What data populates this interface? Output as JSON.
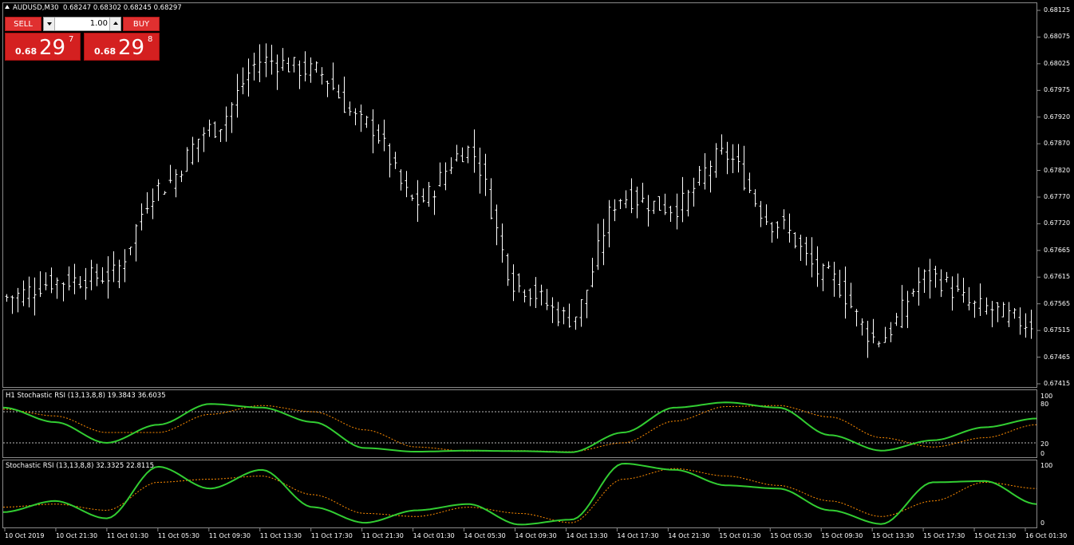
{
  "header": {
    "symbol": "AUDUSD,M30",
    "ohlc": "0.68247 0.68302 0.68245 0.68297"
  },
  "trade_panel": {
    "sell_label": "SELL",
    "buy_label": "BUY",
    "lot": "1.00",
    "sell_price": {
      "prefix": "0.68",
      "big": "29",
      "sup": "7"
    },
    "buy_price": {
      "prefix": "0.68",
      "big": "29",
      "sup": "8"
    }
  },
  "price_axis": [
    "0.68125",
    "0.68075",
    "0.68025",
    "0.67975",
    "0.67920",
    "0.67870",
    "0.67820",
    "0.67770",
    "0.67720",
    "0.67665",
    "0.67615",
    "0.67565",
    "0.67515",
    "0.67465",
    "0.67415"
  ],
  "indicator1": {
    "title": "H1 Stochastic RSI (13,13,8,8) 19.3843 36.6035",
    "levels": [
      "100",
      "80",
      "20",
      "0"
    ]
  },
  "indicator2": {
    "title": "Stochastic RSI (13,13,8,8) 32.3325 22.8115",
    "levels": [
      "100",
      "0"
    ]
  },
  "time_axis": [
    "10 Oct 2019",
    "10 Oct 21:30",
    "11 Oct 01:30",
    "11 Oct 05:30",
    "11 Oct 09:30",
    "11 Oct 13:30",
    "11 Oct 17:30",
    "11 Oct 21:30",
    "14 Oct 01:30",
    "14 Oct 05:30",
    "14 Oct 09:30",
    "14 Oct 13:30",
    "14 Oct 17:30",
    "14 Oct 21:30",
    "15 Oct 01:30",
    "15 Oct 05:30",
    "15 Oct 09:30",
    "15 Oct 13:30",
    "15 Oct 17:30",
    "15 Oct 21:30",
    "16 Oct 01:30"
  ],
  "colors": {
    "background": "#000000",
    "bars": "#ffffff",
    "main_line": "#32cd32",
    "signal_line": "#ff8c00",
    "sell_button": "#e03030"
  },
  "chart_data": [
    {
      "type": "line",
      "name": "price",
      "x": [
        "10 Oct 2019",
        "10 Oct 21:30",
        "11 Oct 01:30",
        "11 Oct 05:30",
        "11 Oct 09:30",
        "11 Oct 13:30",
        "11 Oct 17:30",
        "11 Oct 21:30",
        "14 Oct 01:30",
        "14 Oct 05:30",
        "14 Oct 09:30",
        "14 Oct 13:30",
        "14 Oct 17:30",
        "14 Oct 21:30",
        "15 Oct 01:30",
        "15 Oct 05:30",
        "15 Oct 09:30",
        "15 Oct 13:30",
        "15 Oct 17:30",
        "15 Oct 21:30",
        "16 Oct 01:30"
      ],
      "series": [
        {
          "values": [
            0.6758,
            0.6761,
            0.6762,
            0.6779,
            0.679,
            0.6803,
            0.6801,
            0.6791,
            0.6776,
            0.6786,
            0.676,
            0.6754,
            0.6777,
            0.6775,
            0.6785,
            0.6772,
            0.6762,
            0.675,
            0.6762,
            0.6756,
            0.6753
          ]
        }
      ],
      "ylim": [
        0.67415,
        0.68125
      ]
    },
    {
      "type": "line",
      "x": [
        "10 Oct 2019",
        "10 Oct 21:30",
        "11 Oct 01:30",
        "11 Oct 05:30",
        "11 Oct 09:30",
        "11 Oct 13:30",
        "11 Oct 17:30",
        "11 Oct 21:30",
        "14 Oct 01:30",
        "14 Oct 05:30",
        "14 Oct 09:30",
        "14 Oct 13:30",
        "14 Oct 17:30",
        "14 Oct 21:30",
        "15 Oct 01:30",
        "15 Oct 05:30",
        "15 Oct 09:30",
        "15 Oct 13:30",
        "15 Oct 17:30",
        "15 Oct 21:30",
        "16 Oct 01:30"
      ],
      "series": [
        {
          "values": [
            88,
            60,
            20,
            55,
            95,
            88,
            60,
            10,
            3,
            5,
            4,
            2,
            40,
            88,
            98,
            88,
            35,
            5,
            25,
            50,
            67
          ]
        },
        {
          "values": [
            85,
            72,
            40,
            40,
            75,
            92,
            80,
            45,
            12,
            4,
            5,
            3,
            20,
            62,
            90,
            92,
            70,
            30,
            12,
            30,
            55
          ]
        }
      ],
      "ylim": [
        0,
        100
      ]
    },
    {
      "type": "line",
      "x": [
        "10 Oct 2019",
        "10 Oct 21:30",
        "11 Oct 01:30",
        "11 Oct 05:30",
        "11 Oct 09:30",
        "11 Oct 13:30",
        "11 Oct 17:30",
        "11 Oct 21:30",
        "14 Oct 01:30",
        "14 Oct 05:30",
        "14 Oct 09:30",
        "14 Oct 13:30",
        "14 Oct 17:30",
        "14 Oct 21:30",
        "15 Oct 01:30",
        "15 Oct 05:30",
        "15 Oct 09:30",
        "15 Oct 13:30",
        "15 Oct 17:30",
        "15 Oct 21:30",
        "16 Oct 01:30"
      ],
      "series": [
        {
          "values": [
            22,
            40,
            12,
            95,
            60,
            90,
            30,
            5,
            25,
            35,
            2,
            10,
            100,
            90,
            65,
            60,
            25,
            3,
            70,
            72,
            35
          ]
        },
        {
          "values": [
            30,
            35,
            25,
            70,
            75,
            80,
            50,
            20,
            15,
            30,
            20,
            5,
            75,
            92,
            80,
            65,
            40,
            15,
            40,
            70,
            60
          ]
        }
      ],
      "ylim": [
        0,
        100
      ]
    }
  ]
}
